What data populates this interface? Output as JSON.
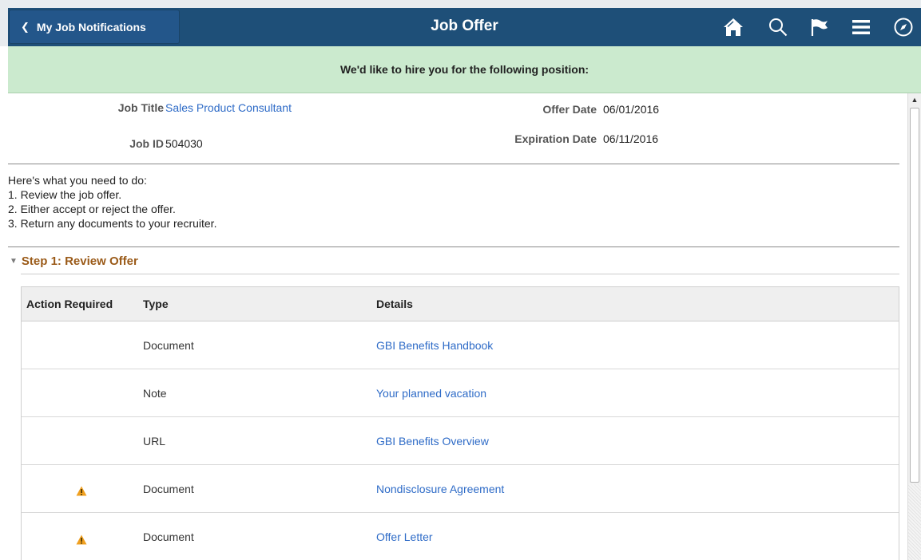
{
  "header": {
    "back_label": "My Job Notifications",
    "title": "Job Offer",
    "icons": [
      "home-icon",
      "search-icon",
      "flag-icon",
      "menu-icon",
      "compass-icon"
    ]
  },
  "banner": {
    "text": "We'd like to hire you for the following position:"
  },
  "offer": {
    "job_title_label": "Job Title",
    "job_title_value": "Sales Product Consultant",
    "job_id_label": "Job ID",
    "job_id_value": "504030",
    "offer_date_label": "Offer Date",
    "offer_date_value": "06/01/2016",
    "expiration_date_label": "Expiration Date",
    "expiration_date_value": "06/11/2016"
  },
  "instructions": [
    "Here's what you need to do:",
    "1. Review the job offer.",
    "2. Either accept or reject the offer.",
    "3. Return any documents to your recruiter."
  ],
  "step1": {
    "title": "Step 1: Review Offer",
    "columns": [
      "Action Required",
      "Type",
      "Details"
    ],
    "rows": [
      {
        "action_required": false,
        "type": "Document",
        "details": "GBI Benefits Handbook"
      },
      {
        "action_required": false,
        "type": "Note",
        "details": "Your planned vacation"
      },
      {
        "action_required": false,
        "type": "URL",
        "details": "GBI Benefits Overview"
      },
      {
        "action_required": true,
        "type": "Document",
        "details": "Nondisclosure Agreement"
      },
      {
        "action_required": true,
        "type": "Document",
        "details": "Offer Letter"
      }
    ]
  },
  "colors": {
    "nav_bg": "#1e4f78",
    "banner_bg": "#cbeace",
    "link": "#2e6bc7",
    "step_title": "#9a5a18",
    "warning": "#f0a020"
  }
}
